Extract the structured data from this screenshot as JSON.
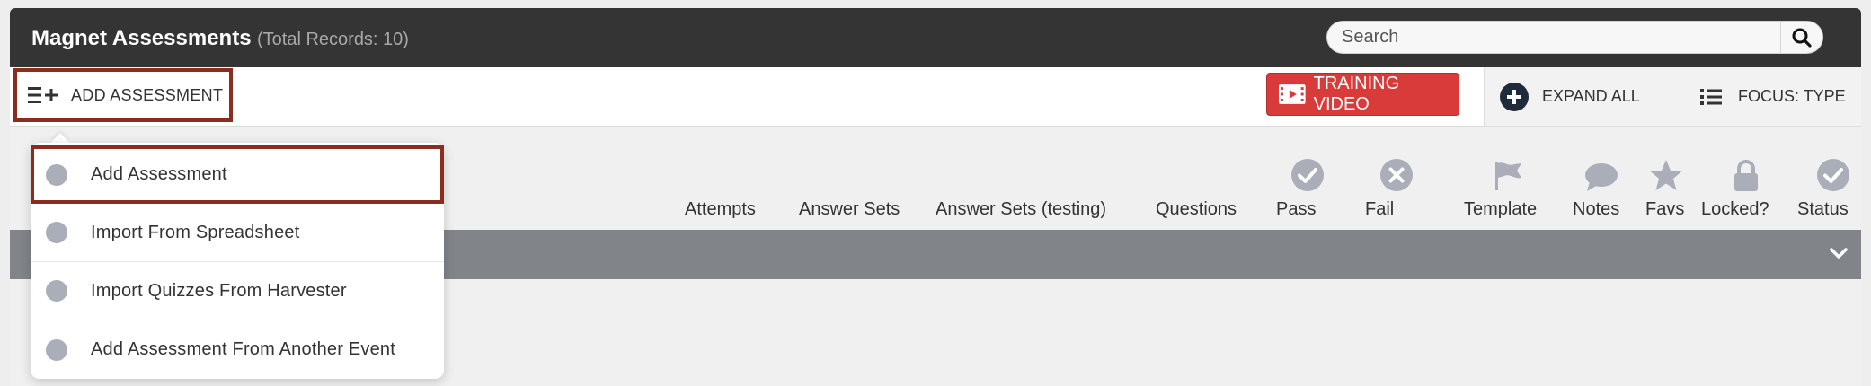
{
  "header": {
    "title": "Magnet Assessments",
    "record_count": "(Total Records: 10)",
    "search": {
      "placeholder": "Search",
      "value": "",
      "icon": "search-icon"
    }
  },
  "toolbar": {
    "add_assessment": {
      "label": "ADD ASSESSMENT",
      "icon": "list-plus-icon"
    },
    "training_video": {
      "label": "TRAINING VIDEO",
      "icon": "video-icon",
      "color": "#d93b3b"
    },
    "expand_all": {
      "label": "EXPAND ALL",
      "icon": "plus-circle-icon"
    },
    "focus": {
      "label": "FOCUS: TYPE",
      "icon": "list-icon"
    }
  },
  "columns": [
    {
      "label": "Attempts"
    },
    {
      "label": "Answer Sets"
    },
    {
      "label": "Answer Sets (testing)"
    },
    {
      "label": "Questions"
    },
    {
      "label": "Pass",
      "icon": "check-circle-icon"
    },
    {
      "label": "Fail",
      "icon": "x-circle-icon"
    },
    {
      "label": "Template",
      "icon": "flag-icon"
    },
    {
      "label": "Notes",
      "icon": "speech-bubble-icon"
    },
    {
      "label": "Favs",
      "icon": "star-icon"
    },
    {
      "label": "Locked?",
      "icon": "lock-icon"
    },
    {
      "label": "Status",
      "icon": "check-circle-icon"
    }
  ],
  "group_bar": {
    "icon": "chevron-down-icon"
  },
  "dropdown": {
    "items": [
      {
        "label": "Add Assessment",
        "highlighted": true
      },
      {
        "label": "Import From Spreadsheet"
      },
      {
        "label": "Import Quizzes From Harvester"
      },
      {
        "label": "Add Assessment From Another Event"
      }
    ]
  },
  "colors": {
    "header_bg": "#343434",
    "highlight_border": "#8b2c1e",
    "group_bar": "#818589",
    "icon_gray": "#a9aeb8"
  }
}
